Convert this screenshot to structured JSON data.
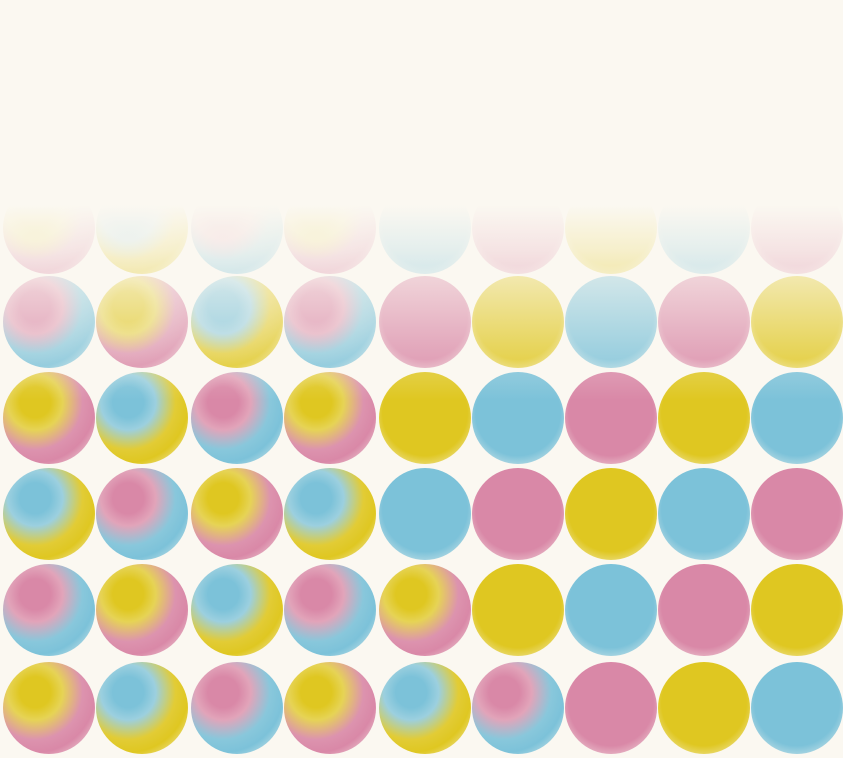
{
  "colors": {
    "background": "#fbf8f1",
    "yellow": "#dfc721",
    "cyan": "#7cc2d9",
    "pink": "#d988a7"
  },
  "grid": {
    "rows": [
      {
        "row": 0,
        "dots": [
          {
            "inner": "yellow",
            "outer": "pink"
          },
          {
            "inner": "cyan",
            "outer": "yellow"
          },
          {
            "inner": "pink",
            "outer": "cyan"
          },
          {
            "inner": "yellow",
            "outer": "pink"
          },
          {
            "inner": "cyan",
            "outer": "cyan"
          },
          {
            "inner": "pink",
            "outer": "pink"
          },
          {
            "inner": "yellow",
            "outer": "yellow"
          },
          {
            "inner": "cyan",
            "outer": "cyan"
          },
          {
            "inner": "pink",
            "outer": "pink"
          }
        ]
      },
      {
        "row": 1,
        "dots": [
          {
            "inner": "pink",
            "outer": "cyan"
          },
          {
            "inner": "yellow",
            "outer": "pink"
          },
          {
            "inner": "cyan",
            "outer": "yellow"
          },
          {
            "inner": "pink",
            "outer": "cyan"
          },
          {
            "inner": "pink",
            "outer": "pink"
          },
          {
            "inner": "yellow",
            "outer": "yellow"
          },
          {
            "inner": "cyan",
            "outer": "cyan"
          },
          {
            "inner": "pink",
            "outer": "pink"
          },
          {
            "inner": "yellow",
            "outer": "yellow"
          }
        ]
      },
      {
        "row": 2,
        "dots": [
          {
            "inner": "yellow",
            "outer": "pink"
          },
          {
            "inner": "cyan",
            "outer": "yellow"
          },
          {
            "inner": "pink",
            "outer": "cyan"
          },
          {
            "inner": "yellow",
            "outer": "pink"
          },
          {
            "inner": "yellow",
            "outer": "yellow"
          },
          {
            "inner": "cyan",
            "outer": "cyan"
          },
          {
            "inner": "pink",
            "outer": "pink"
          },
          {
            "inner": "yellow",
            "outer": "yellow"
          },
          {
            "inner": "cyan",
            "outer": "cyan"
          }
        ]
      },
      {
        "row": 3,
        "dots": [
          {
            "inner": "cyan",
            "outer": "yellow"
          },
          {
            "inner": "pink",
            "outer": "cyan"
          },
          {
            "inner": "yellow",
            "outer": "pink"
          },
          {
            "inner": "cyan",
            "outer": "yellow"
          },
          {
            "inner": "cyan",
            "outer": "cyan"
          },
          {
            "inner": "pink",
            "outer": "pink"
          },
          {
            "inner": "yellow",
            "outer": "yellow"
          },
          {
            "inner": "cyan",
            "outer": "cyan"
          },
          {
            "inner": "pink",
            "outer": "pink"
          }
        ]
      },
      {
        "row": 4,
        "dots": [
          {
            "inner": "pink",
            "outer": "cyan"
          },
          {
            "inner": "yellow",
            "outer": "pink"
          },
          {
            "inner": "cyan",
            "outer": "yellow"
          },
          {
            "inner": "pink",
            "outer": "cyan"
          },
          {
            "inner": "yellow",
            "outer": "pink"
          },
          {
            "inner": "yellow",
            "outer": "yellow"
          },
          {
            "inner": "cyan",
            "outer": "cyan"
          },
          {
            "inner": "pink",
            "outer": "pink"
          },
          {
            "inner": "yellow",
            "outer": "yellow"
          }
        ]
      },
      {
        "row": 5,
        "dots": [
          {
            "inner": "yellow",
            "outer": "pink"
          },
          {
            "inner": "cyan",
            "outer": "yellow"
          },
          {
            "inner": "pink",
            "outer": "cyan"
          },
          {
            "inner": "yellow",
            "outer": "pink"
          },
          {
            "inner": "cyan",
            "outer": "yellow"
          },
          {
            "inner": "pink",
            "outer": "cyan"
          },
          {
            "inner": "pink",
            "outer": "pink"
          },
          {
            "inner": "yellow",
            "outer": "yellow"
          },
          {
            "inner": "cyan",
            "outer": "cyan"
          }
        ]
      }
    ]
  }
}
